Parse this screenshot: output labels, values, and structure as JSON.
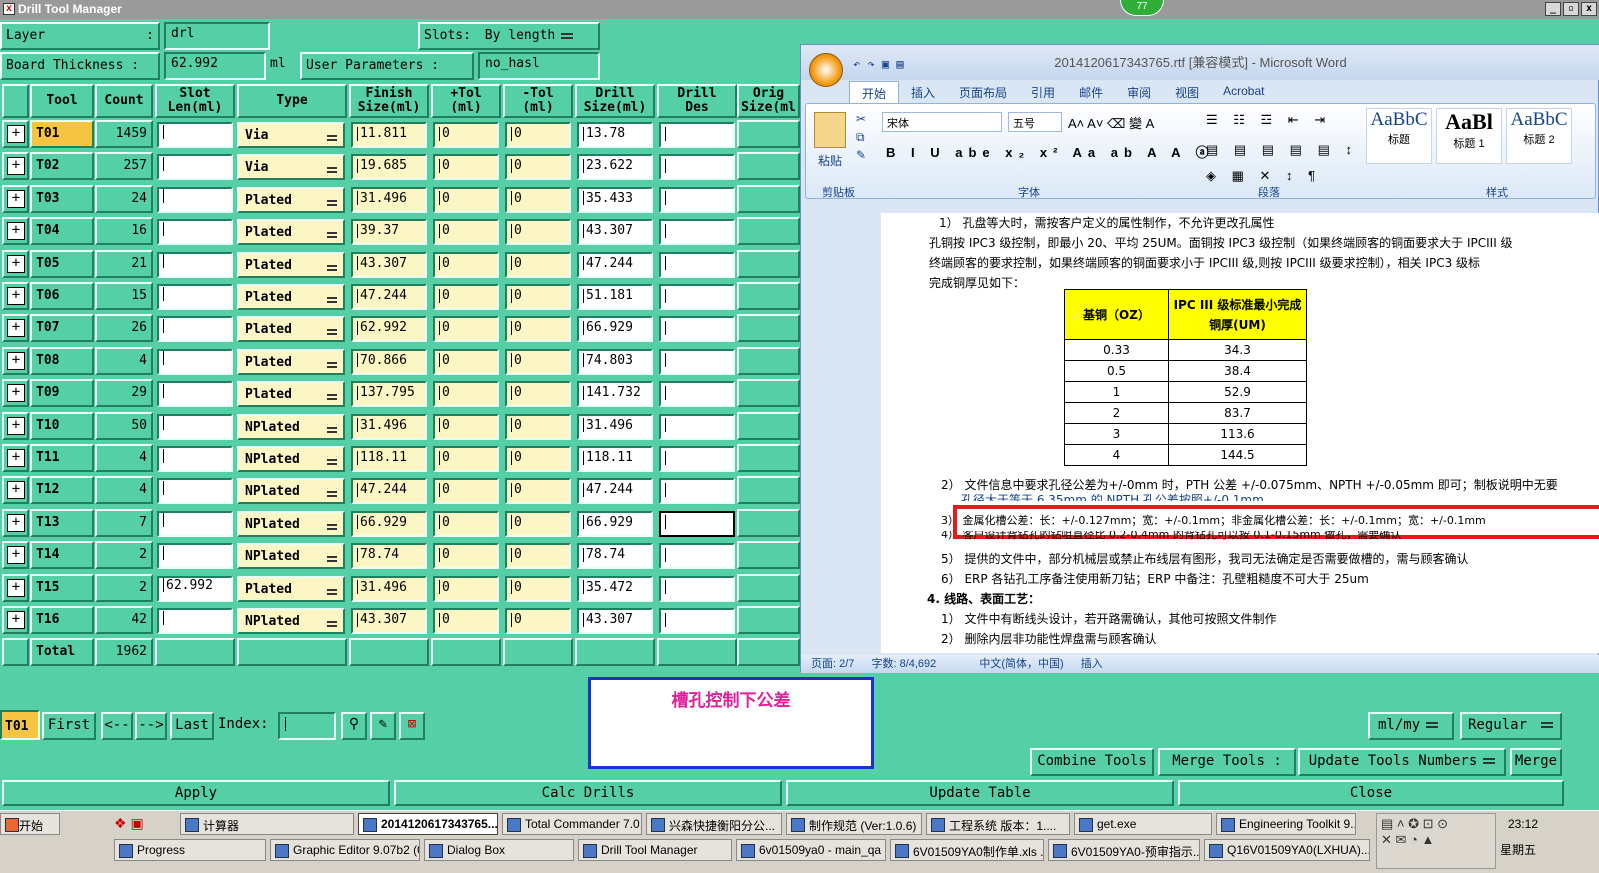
{
  "window": {
    "title": "Drill Tool Manager"
  },
  "badge": "77",
  "layer": {
    "label": "Layer",
    "sep": ":",
    "value": "drl"
  },
  "slots": {
    "label": "Slots:",
    "value": "By length"
  },
  "board": {
    "label": "Board Thickness :",
    "value": "62.992",
    "unit": "ml"
  },
  "user_params": {
    "label": "User Parameters :",
    "value": "no_hasl"
  },
  "columns": [
    "Tool",
    "Count",
    "Slot\nLen(ml)",
    "Type",
    "Finish\nSize(ml)",
    "+Tol\n(ml)",
    "-Tol\n(ml)",
    "Drill\nSize(ml)",
    "Drill\nDes",
    "Orig\nSize(ml"
  ],
  "rows": [
    {
      "tool": "T01",
      "count": "1459",
      "slot": "",
      "type": "Via",
      "finish": "11.811",
      "ptol": "0",
      "ntol": "0",
      "drill": "13.78"
    },
    {
      "tool": "T02",
      "count": "257",
      "slot": "",
      "type": "Via",
      "finish": "19.685",
      "ptol": "0",
      "ntol": "0",
      "drill": "23.622"
    },
    {
      "tool": "T03",
      "count": "24",
      "slot": "",
      "type": "Plated",
      "finish": "31.496",
      "ptol": "0",
      "ntol": "0",
      "drill": "35.433"
    },
    {
      "tool": "T04",
      "count": "16",
      "slot": "",
      "type": "Plated",
      "finish": "39.37",
      "ptol": "0",
      "ntol": "0",
      "drill": "43.307"
    },
    {
      "tool": "T05",
      "count": "21",
      "slot": "",
      "type": "Plated",
      "finish": "43.307",
      "ptol": "0",
      "ntol": "0",
      "drill": "47.244"
    },
    {
      "tool": "T06",
      "count": "15",
      "slot": "",
      "type": "Plated",
      "finish": "47.244",
      "ptol": "0",
      "ntol": "0",
      "drill": "51.181"
    },
    {
      "tool": "T07",
      "count": "26",
      "slot": "",
      "type": "Plated",
      "finish": "62.992",
      "ptol": "0",
      "ntol": "0",
      "drill": "66.929"
    },
    {
      "tool": "T08",
      "count": "4",
      "slot": "",
      "type": "Plated",
      "finish": "70.866",
      "ptol": "0",
      "ntol": "0",
      "drill": "74.803"
    },
    {
      "tool": "T09",
      "count": "29",
      "slot": "",
      "type": "Plated",
      "finish": "137.795",
      "ptol": "0",
      "ntol": "0",
      "drill": "141.732"
    },
    {
      "tool": "T10",
      "count": "50",
      "slot": "",
      "type": "NPlated",
      "finish": "31.496",
      "ptol": "0",
      "ntol": "0",
      "drill": "31.496"
    },
    {
      "tool": "T11",
      "count": "4",
      "slot": "",
      "type": "NPlated",
      "finish": "118.11",
      "ptol": "0",
      "ntol": "0",
      "drill": "118.11"
    },
    {
      "tool": "T12",
      "count": "4",
      "slot": "",
      "type": "NPlated",
      "finish": "47.244",
      "ptol": "0",
      "ntol": "0",
      "drill": "47.244"
    },
    {
      "tool": "T13",
      "count": "7",
      "slot": "",
      "type": "NPlated",
      "finish": "66.929",
      "ptol": "0",
      "ntol": "0",
      "drill": "66.929"
    },
    {
      "tool": "T14",
      "count": "2",
      "slot": "",
      "type": "NPlated",
      "finish": "78.74",
      "ptol": "0",
      "ntol": "0",
      "drill": "78.74"
    },
    {
      "tool": "T15",
      "count": "2",
      "slot": "62.992",
      "type": "Plated",
      "finish": "31.496",
      "ptol": "0",
      "ntol": "0",
      "drill": "35.472"
    },
    {
      "tool": "T16",
      "count": "42",
      "slot": "",
      "type": "NPlated",
      "finish": "43.307",
      "ptol": "0",
      "ntol": "0",
      "drill": "43.307"
    }
  ],
  "total": {
    "label": "Total",
    "value": "1962"
  },
  "nav": {
    "current": "T01",
    "first": "First",
    "prev": "<--",
    "next": "-->",
    "last": "Last",
    "index_label": "Index:",
    "units": "ml/my",
    "mode": "Regular"
  },
  "note_text": "槽孔控制下公差",
  "tools_row": {
    "combine": "Combine Tools",
    "merge_label": "Merge Tools :",
    "update_numbers": "Update Tools Numbers",
    "merge": "Merge"
  },
  "actions": {
    "apply": "Apply",
    "calc": "Calc Drills",
    "update_table": "Update Table",
    "close": "Close"
  },
  "word": {
    "title": "2014120617343765.rtf [兼容模式] - Microsoft Word",
    "tabs": [
      "开始",
      "插入",
      "页面布局",
      "引用",
      "邮件",
      "审阅",
      "视图",
      "Acrobat"
    ],
    "font": "宋体",
    "size": "五号",
    "groups": [
      "剪贴板",
      "字体",
      "段落",
      "样式"
    ],
    "paste": "粘贴",
    "styles": [
      {
        "sample": "AaBbC",
        "name": "标题"
      },
      {
        "sample": "AaBl",
        "name": "标题 1"
      },
      {
        "sample": "AaBbC",
        "name": "标题 2"
      }
    ],
    "lines": [
      "1） 孔盘等大时，需按客户定义的属性制作，不允许更改孔属性",
      "孔铜按 IPC3 级控制，即最小 20、平均 25UM。面铜按 IPC3 级控制（如果终端顾客的铜面要求大于 IPCIII 级",
      "终端顾客的要求控制，如果终端顾客的铜面要求小于 IPCIII 级,则按 IPCIII 级要求控制），相关 IPC3 级标",
      "完成铜厚见如下："
    ],
    "table_headers": [
      "基铜（OZ）",
      "IPC III 级标准最小完成铜厚(UM)"
    ],
    "table_rows": [
      [
        "0.33",
        "34.3"
      ],
      [
        "0.5",
        "38.4"
      ],
      [
        "1",
        "52.9"
      ],
      [
        "2",
        "83.7"
      ],
      [
        "3",
        "113.6"
      ],
      [
        "4",
        "144.5"
      ]
    ],
    "line2": "2） 文件信息中要求孔径公差为+/-0mm 时，PTH 公差 +/-0.075mm、NPTH +/-0.05mm 即可；制板说明中无要",
    "line2b": "孔径大于等于 6.35mm 的 NPTH 孔公差按照+/-0.1mm",
    "line3": "3） 金属化槽公差：长：+/-0.127mm；宽：+/-0.1mm；非金属化槽公差：长：+/-0.1mm；宽：+/-0.1mm",
    "line4": "4） 客户设计背钻孔的钻咀直径比 0.2-0.4mm 的背钻孔可以按 0.1-0.15mm 做孔，需要确认",
    "line5": "5） 提供的文件中，部分机械层或禁止布线层有图形，我司无法确定是否需要做槽的，需与顾客确认",
    "line6": "6） ERP 各钻孔工序备注使用新刀钻；ERP 中备注：孔壁粗糙度不可大于 25um",
    "heading4": "4.  线路、表面工艺：",
    "line7": "1） 文件中有断线头设计，若开路需确认，其他可按照文件制作",
    "line8": "2） 删除内层非功能性焊盘需与顾客确认",
    "status": {
      "page": "页面: 2/7",
      "words": "字数: 8/4,692",
      "lang": "中文(简体，中国)",
      "mode": "插入"
    }
  },
  "taskbar": {
    "start": "开始",
    "row1": [
      "计算器",
      "2014120617343765...",
      "Total Commander 7.0...",
      "兴森快捷衡阳分公...",
      "制作规范 (Ver:1.0.6)",
      "工程系统  版本：1....",
      "get.exe",
      "Engineering Toolkit 9...."
    ],
    "row2": [
      "Progress",
      "Graphic Editor 9.07b2 (0...",
      "Dialog Box",
      "Drill Tool Manager",
      "6v01509ya0 - main_qa",
      "6V01509YA0制作单.xls ...",
      "6V01509YA0-预审指示...",
      "Q16V01509YA0(LXHUA)..."
    ],
    "time": "23:12",
    "day": "星期五"
  }
}
